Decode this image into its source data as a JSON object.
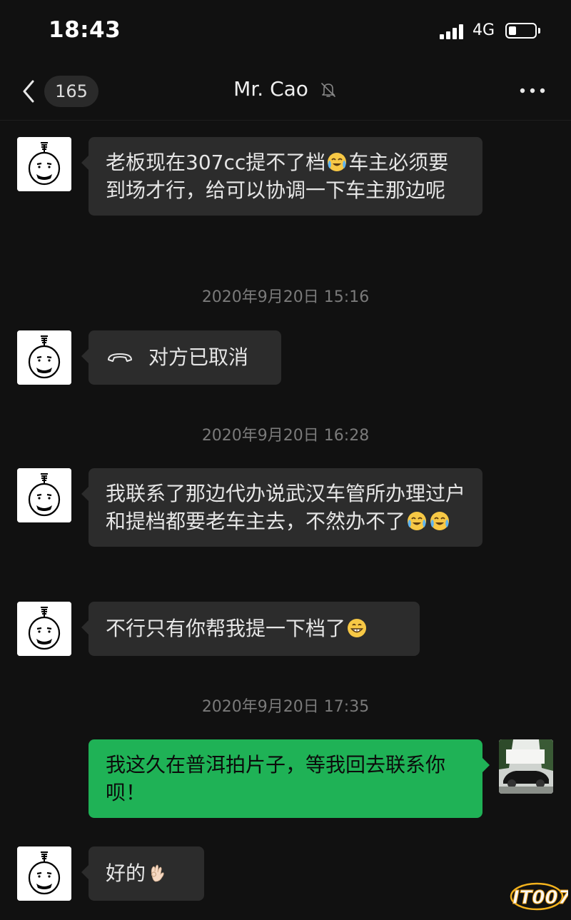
{
  "status_bar": {
    "time": "18:43",
    "network": "4G",
    "battery_level": 0.3
  },
  "nav": {
    "unread_count": "165",
    "contact_name": "Mr. Cao",
    "muted_icon": "bell-slash-icon",
    "more_icon": "more-dots-icon",
    "back_icon": "chevron-left-icon"
  },
  "messages": [
    {
      "from": "them",
      "text_a": "老板现在307cc提不了档",
      "emoji_a": "crying-laughing",
      "text_b": "车主必须要到场才行，给可以协调一下车主那边呢"
    },
    {
      "type": "timestamp",
      "text": "2020年9月20日 15:16"
    },
    {
      "from": "them",
      "call_icon": "hangup-phone-icon",
      "text": "对方已取消"
    },
    {
      "type": "timestamp",
      "text": "2020年9月20日 16:28"
    },
    {
      "from": "them",
      "text": "我联系了那边代办说武汉车管所办理过户和提档都要老车主去，不然办不了",
      "emojis": [
        "crying-laughing",
        "crying-laughing"
      ]
    },
    {
      "from": "them",
      "text": "不行只有你帮我提一下档了",
      "emoji": "grinning"
    },
    {
      "type": "timestamp",
      "text": "2020年9月20日 17:35"
    },
    {
      "from": "me",
      "text": "我这久在普洱拍片子，等我回去联系你呗！"
    },
    {
      "from": "them",
      "text": "好的",
      "emoji": "ok-hand"
    }
  ],
  "watermark": {
    "text": "IT007"
  },
  "colors": {
    "background": "#111111",
    "incoming_bubble": "#2c2c2c",
    "outgoing_bubble": "#1fb256",
    "timestamp": "#7a7a7a"
  }
}
